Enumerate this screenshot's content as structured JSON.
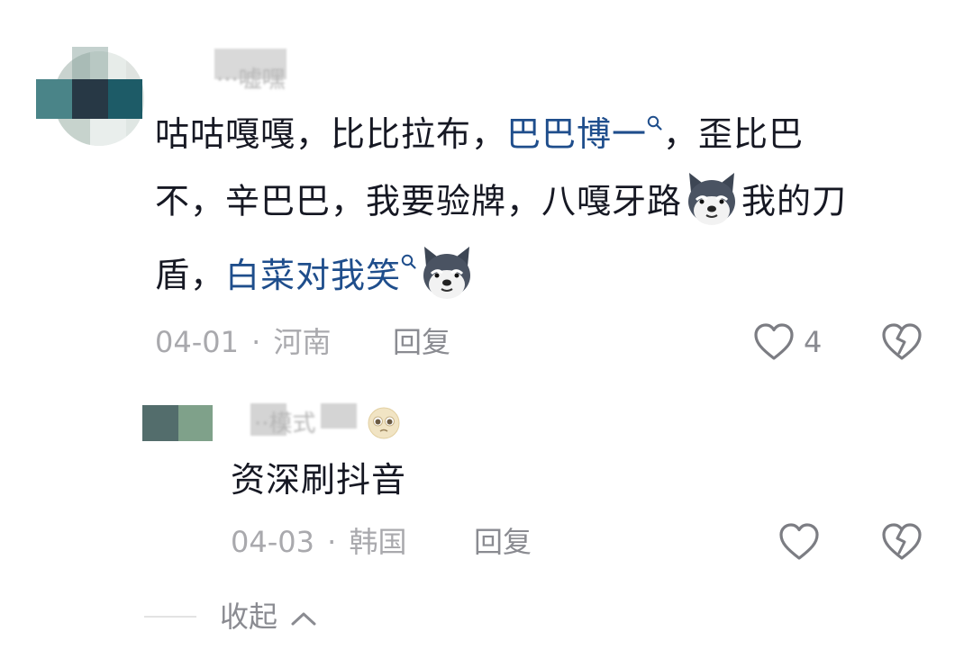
{
  "comment": {
    "username": "···嘘嘿",
    "text_line1_a": "咕咕嘎嘎，比比拉布，",
    "text_line1_link": "巴巴博一",
    "text_line1_b": "，歪比巴",
    "text_line2_a": "不，辛巴巴，我要验牌，八嘎牙路",
    "text_line2_b": "我的刀",
    "text_line3_a": "盾，",
    "text_line3_link": "白菜对我笑",
    "date": "04-01",
    "separator": "·",
    "location": "河南",
    "reply_label": "回复",
    "like_count": "4"
  },
  "reply": {
    "username": "··模式",
    "text": "资深刷抖音",
    "date": "04-03",
    "separator": "·",
    "location": "韩国",
    "reply_label": "回复"
  },
  "collapse_label": "收起",
  "icons": {
    "search_hint": "magnifier-icon",
    "emoji": "doge-emoji-icon",
    "like": "heart-outline-icon",
    "dislike": "broken-heart-icon",
    "pleading": "pleading-face-emoji-icon",
    "collapse": "chevron-up-icon"
  },
  "colors": {
    "link": "#1f4e8c",
    "text": "#161823",
    "meta": "#a9a9ad",
    "action": "#8a8b91"
  }
}
